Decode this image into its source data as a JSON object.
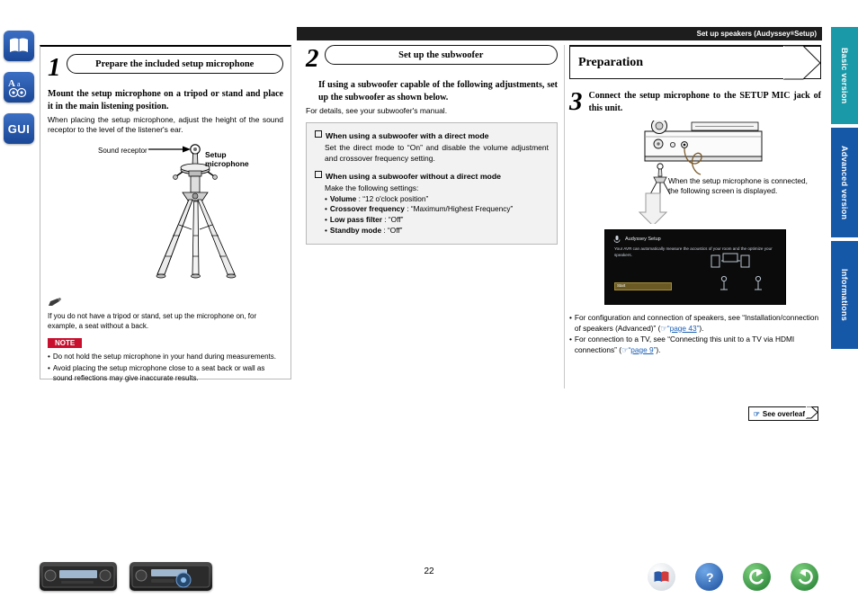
{
  "header": {
    "running_title_pre": "Set up speakers (Audyssey",
    "running_title_sup": "®",
    "running_title_post": " Setup)"
  },
  "side_tabs": [
    {
      "label": "Basic version",
      "color": "#1a9aa8"
    },
    {
      "label": "Advanced version",
      "color": "#1658a8"
    },
    {
      "label": "Informations",
      "color": "#1658a8"
    }
  ],
  "left_rail": [
    {
      "name": "book-icon",
      "label": ""
    },
    {
      "name": "text-size-icon",
      "label": ""
    },
    {
      "name": "gui-icon",
      "label": "GUI"
    }
  ],
  "step1": {
    "number": "1",
    "title": "Prepare the included setup microphone",
    "lead": "Mount the setup microphone on a tripod or stand and place it in the main listening position.",
    "body": "When placing the setup microphone, adjust the height of the sound receptor to the level of the listener's ear.",
    "figure": {
      "label_receptor": "Sound receptor",
      "label_mic": "Setup\nmicrophone",
      "label_mic_line1": "Setup",
      "label_mic_line2": "microphone"
    },
    "tip": "If you do not have a tripod or stand, set up the microphone on, for example, a seat without a back.",
    "note_tag": "NOTE",
    "notes": [
      "Do not hold the setup microphone in your hand during measurements.",
      "Avoid placing the setup microphone close to a seat back or wall as sound reflections may give inaccurate results."
    ]
  },
  "step2": {
    "number": "2",
    "title": "Set up the subwoofer",
    "lead": "If using a subwoofer capable of the following adjustments, set up the subwoofer as shown below.",
    "body": "For details, see your subwoofer's manual.",
    "section1": {
      "heading": "When using a subwoofer with a direct mode",
      "text": "Set the direct mode to “On” and disable the volume adjustment and crossover frequency setting."
    },
    "section2": {
      "heading": "When using a subwoofer without a direct mode",
      "text": "Make the following settings:",
      "items": [
        {
          "label": "Volume",
          "value": "“12 o'clock position”"
        },
        {
          "label": "Crossover frequency",
          "value": "“Maximum/Highest Frequency”"
        },
        {
          "label": "Low pass filter",
          "value": "“Off”"
        },
        {
          "label": "Standby mode",
          "value": "“Off”"
        }
      ]
    }
  },
  "preparation": {
    "title": "Preparation",
    "step3": {
      "number": "3",
      "text": "Connect the setup microphone to the SETUP MIC jack of this unit."
    },
    "caption": "When the setup microphone is connected, the following screen is displayed.",
    "screen": {
      "title": "Audyssey Setup",
      "description": "Your AVR can automatically measure the acoustics of your room and the optimize your speakers.",
      "button": "Start"
    },
    "bullets": [
      {
        "text_before": "For configuration and connection of speakers, see “Installation/connection of speakers (Advanced)” (",
        "link": "page 43",
        "text_after": ")."
      },
      {
        "text_before": "For connection to a TV, see “Connecting this unit to a TV via HDMI connections” (",
        "link": "page 9",
        "text_after": ")."
      }
    ],
    "overleaf": "See overleaf"
  },
  "footer": {
    "page_number": "22",
    "icons": [
      "book-icon",
      "help-icon",
      "back-icon",
      "forward-icon"
    ]
  }
}
